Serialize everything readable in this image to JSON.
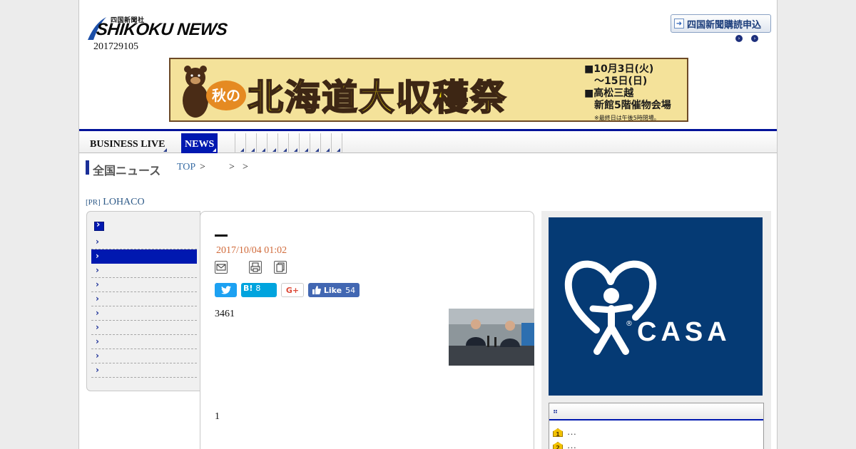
{
  "header": {
    "logo_small": "四国新聞社",
    "logo_main": "SHIKOKU NEWS",
    "edition": "201729105",
    "subscribe_label": "四国新聞購読申込"
  },
  "banner": {
    "aki": "秋の",
    "title": "北海道大収穫祭",
    "info_line1": "■10月3日(火)",
    "info_line2": "〜15日(日)",
    "info_line3": "■高松三越",
    "info_line4": "新館5階催物会場",
    "info_note": "※最終日は午後5時閉場。"
  },
  "nav": {
    "items": [
      {
        "label": "BUSINESS LIVE",
        "active": false
      },
      {
        "label": "NEWS",
        "active": true
      }
    ]
  },
  "breadcrumb": {
    "title": "全国ニュース",
    "top": "TOP",
    "sep1": ">",
    "sep2": ">",
    "sep3": ">"
  },
  "pr": {
    "tag": "[PR]",
    "label": "LOHACO"
  },
  "article": {
    "date": "2017/10/04 01:02",
    "body_number": "3461",
    "footer_number": "1",
    "social": {
      "hatena_label": "B!",
      "hatena_count": "8",
      "gplus_label": "G+",
      "like_label": "Like",
      "like_count": "54"
    }
  },
  "ad": {
    "brand": "CASA",
    "reg": "®"
  },
  "ranking": {
    "items": [
      {
        "rank": "1",
        "text": "…"
      },
      {
        "rank": "2",
        "text": "…"
      }
    ]
  },
  "colors": {
    "nav_accent": "#0018b0",
    "date": "#d06a3a",
    "casa_bg": "#053a74",
    "twitter": "#1da1f2",
    "hatena": "#00a4de",
    "facebook": "#4267b2"
  }
}
